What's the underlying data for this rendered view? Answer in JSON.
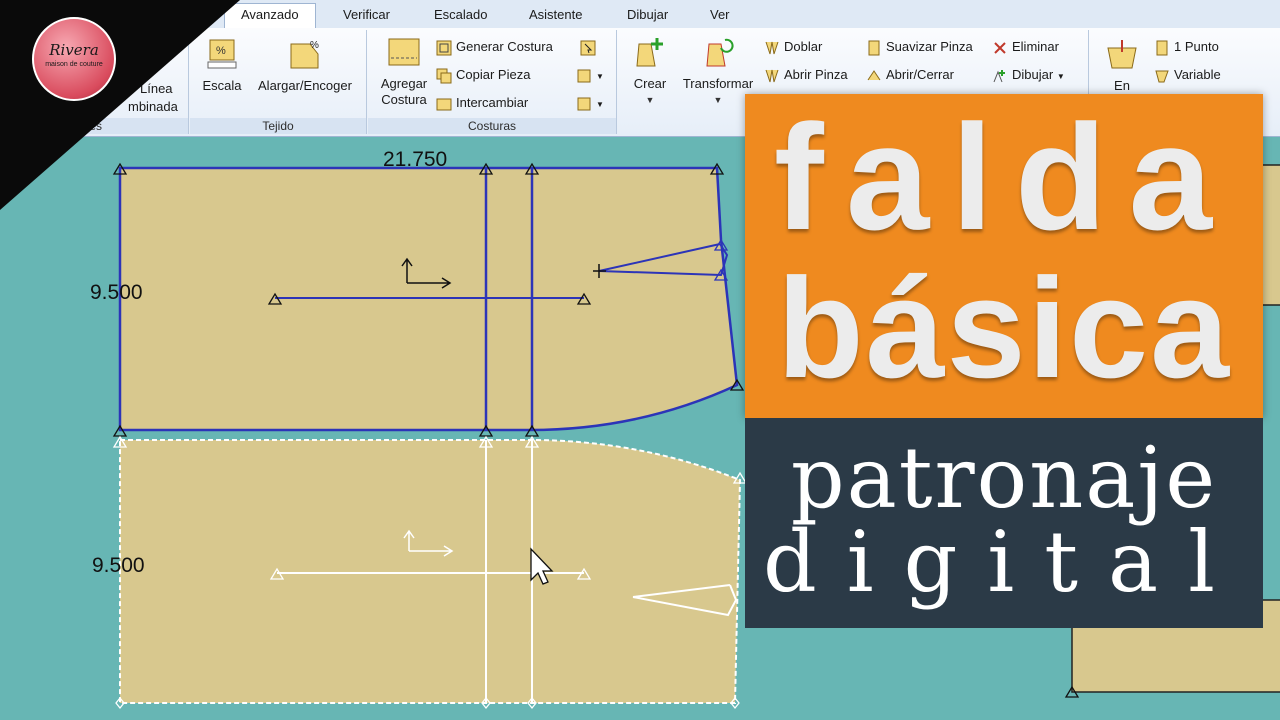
{
  "ribbon": {
    "tabs": [
      "Avanzado",
      "Verificar",
      "Escalado",
      "Asistente",
      "Dibujar",
      "Ver"
    ],
    "active_tab": "Avanzado",
    "groups": {
      "partial": {
        "caption": "es",
        "button_line1": "Línea",
        "button_line2": "mbinada"
      },
      "tejido": {
        "caption": "Tejido",
        "escala": "Escala",
        "alargar": "Alargar/Encoger"
      },
      "costuras": {
        "caption": "Costuras",
        "agregar_line1": "Agregar",
        "agregar_line2": "Costura",
        "generar": "Generar Costura",
        "copiar": "Copiar Pieza",
        "intercambiar": "Intercambiar"
      },
      "piezas": {
        "crear": "Crear",
        "transformar": "Transformar",
        "doblar": "Doblar",
        "abrir_pinza": "Abrir Pinza",
        "suavizar": "Suavizar Pinza",
        "abrir_cerrar": "Abrir/Cerrar",
        "eliminar": "Eliminar",
        "dibujar": "Dibujar"
      },
      "puntos": {
        "en": "En",
        "un_punto": "1 Punto",
        "variable": "Variable"
      }
    }
  },
  "logo": {
    "word": "Rivera",
    "subtitle": "maison de couture"
  },
  "canvas": {
    "dim_top": "21.750",
    "dim_left_upper": "9.500",
    "dim_left_lower": "9.500"
  },
  "title": {
    "line1": "falda",
    "line2": "básica",
    "line3": "patronaje",
    "line4": "digital"
  },
  "colors": {
    "canvas_bg": "#67b6b4",
    "piece_fill": "#d8c88e",
    "selected_line": "#2c34b8",
    "orange": "#ef8a1f",
    "dark": "#2b3a47"
  }
}
